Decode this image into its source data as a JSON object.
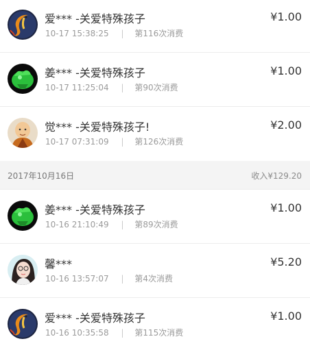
{
  "entries_top": [
    {
      "name": "爱*** -关爱特殊孩子",
      "date": "10-17",
      "time": "15:38:25",
      "count": "第116次消费",
      "amount": "¥1.00",
      "avatar": "koi-fish-avatar"
    },
    {
      "name": "姜*** -关爱特殊孩子",
      "date": "10-17",
      "time": "11:25:04",
      "count": "第90次消费",
      "amount": "¥1.00",
      "avatar": "green-plant-avatar"
    },
    {
      "name": "觉*** -关爱特殊孩子!",
      "date": "10-17",
      "time": "07:31:09",
      "count": "第126次消费",
      "amount": "¥2.00",
      "avatar": "monk-avatar"
    }
  ],
  "date_header": {
    "date": "2017年10月16日",
    "income": "收入¥129.20"
  },
  "entries_bottom": [
    {
      "name": "姜*** -关爱特殊孩子",
      "date": "10-16",
      "time": "21:10:49",
      "count": "第89次消费",
      "amount": "¥1.00",
      "avatar": "green-plant-avatar"
    },
    {
      "name": "馨***",
      "date": "10-16",
      "time": "13:57:07",
      "count": "第4次消费",
      "amount": "¥5.20",
      "avatar": "girl-photo-avatar"
    },
    {
      "name": "爱*** -关爱特殊孩子",
      "date": "10-16",
      "time": "10:35:58",
      "count": "第115次消费",
      "amount": "¥1.00",
      "avatar": "koi-fish-avatar"
    }
  ],
  "separator": "|"
}
